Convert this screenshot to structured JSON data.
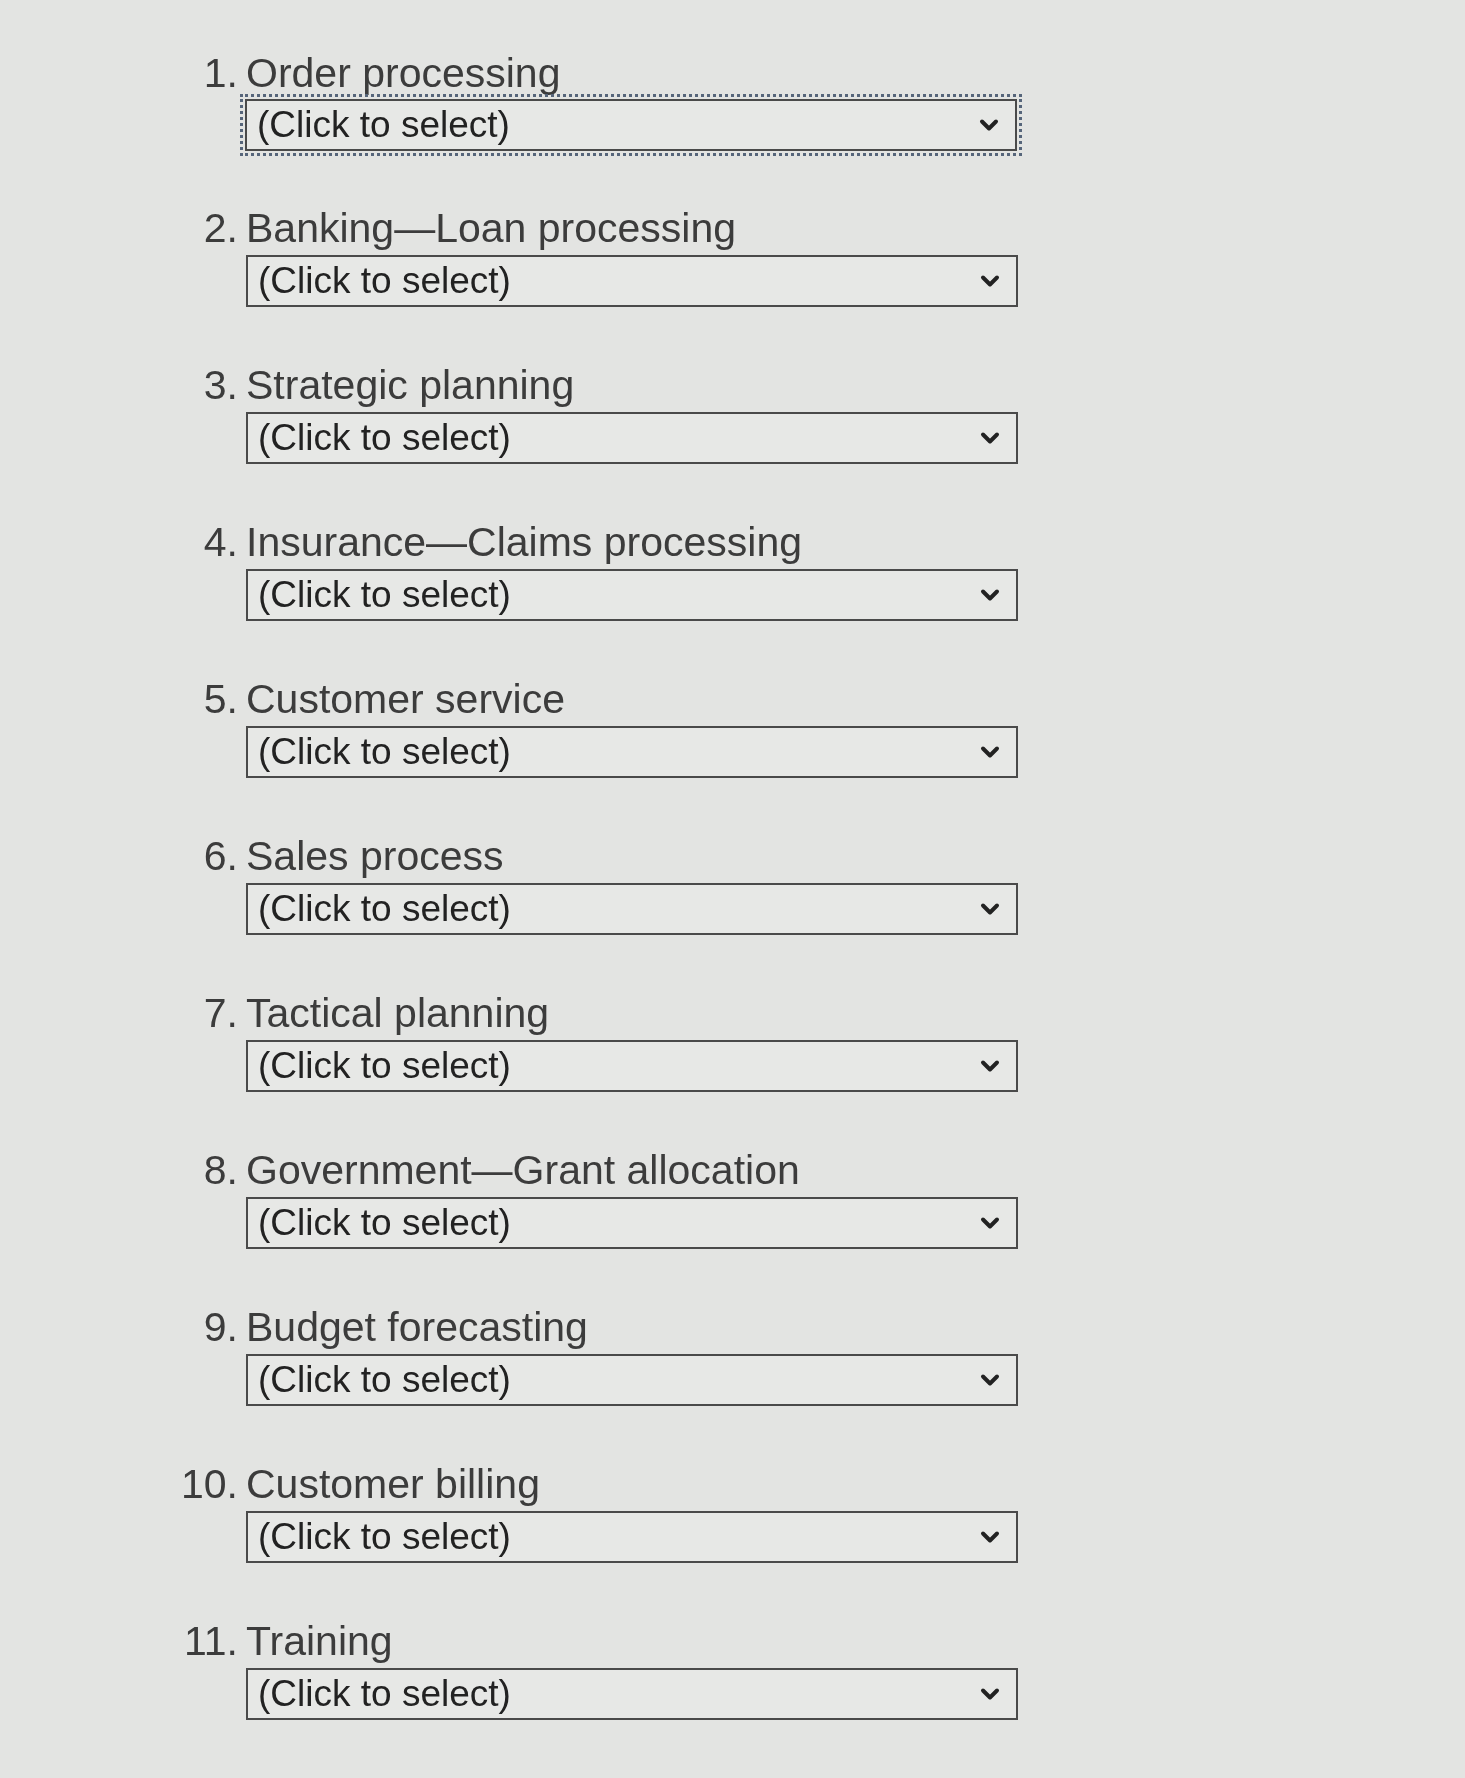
{
  "questions": [
    {
      "number": "1.",
      "label": "Order processing",
      "dropdown": {
        "value": "(Click to select)",
        "focused": true
      }
    },
    {
      "number": "2.",
      "label": "Banking—Loan processing",
      "dropdown": {
        "value": "(Click to select)",
        "focused": false
      }
    },
    {
      "number": "3.",
      "label": "Strategic planning",
      "dropdown": {
        "value": "(Click to select)",
        "focused": false
      }
    },
    {
      "number": "4.",
      "label": "Insurance—Claims processing",
      "dropdown": {
        "value": "(Click to select)",
        "focused": false
      }
    },
    {
      "number": "5.",
      "label": "Customer service",
      "dropdown": {
        "value": "(Click to select)",
        "focused": false
      }
    },
    {
      "number": "6.",
      "label": "Sales process",
      "dropdown": {
        "value": "(Click to select)",
        "focused": false
      }
    },
    {
      "number": "7.",
      "label": "Tactical planning",
      "dropdown": {
        "value": "(Click to select)",
        "focused": false
      }
    },
    {
      "number": "8.",
      "label": "Government—Grant allocation",
      "dropdown": {
        "value": "(Click to select)",
        "focused": false
      }
    },
    {
      "number": "9.",
      "label": "Budget forecasting",
      "dropdown": {
        "value": "(Click to select)",
        "focused": false
      }
    },
    {
      "number": "10.",
      "label": "Customer billing",
      "dropdown": {
        "value": "(Click to select)",
        "focused": false
      }
    },
    {
      "number": "11.",
      "label": "Training",
      "dropdown": {
        "value": "(Click to select)",
        "focused": false
      }
    }
  ]
}
